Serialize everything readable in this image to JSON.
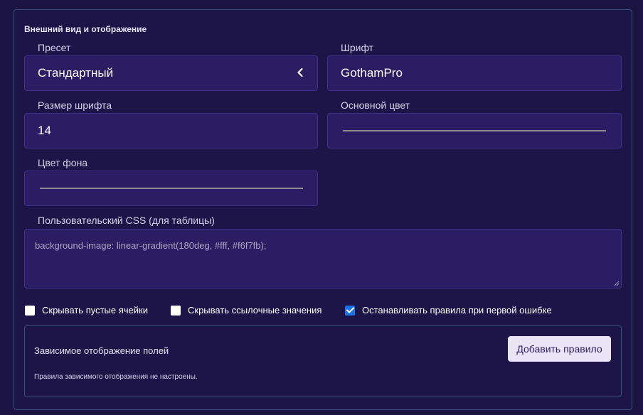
{
  "section": {
    "title": "Внешний вид и отображение"
  },
  "preset": {
    "label": "Пресет",
    "value": "Стандартный"
  },
  "font": {
    "label": "Шрифт",
    "value": "GothamPro"
  },
  "font_size": {
    "label": "Размер шрифта",
    "value": "14"
  },
  "main_color": {
    "label": "Основной цвет"
  },
  "bg_color": {
    "label": "Цвет фона"
  },
  "custom_css": {
    "label": "Пользовательский CSS (для таблицы)",
    "value": "background-image: linear-gradient(180deg, #fff, #f6f7fb);"
  },
  "checkboxes": [
    {
      "label": "Скрывать пустые ячейки",
      "checked": false
    },
    {
      "label": "Скрывать ссылочные значения",
      "checked": false
    },
    {
      "label": "Останавливать правила при первой ошибке",
      "checked": true
    }
  ],
  "conditional_display": {
    "title": "Зависимое отображение полей",
    "add_button_label": "Добавить правило",
    "empty_note": "Правила зависимого отображения не настроены."
  },
  "colors": {
    "background": "#1b1442",
    "field_bg": "#2a1d63",
    "border": "#3b4f7e",
    "checkbox_checked": "#1a73e8"
  },
  "icons": {
    "preset_toggle": "chevron-left-icon",
    "textarea_resize": "resize-handle-icon",
    "checkmark": "checkmark-icon"
  }
}
